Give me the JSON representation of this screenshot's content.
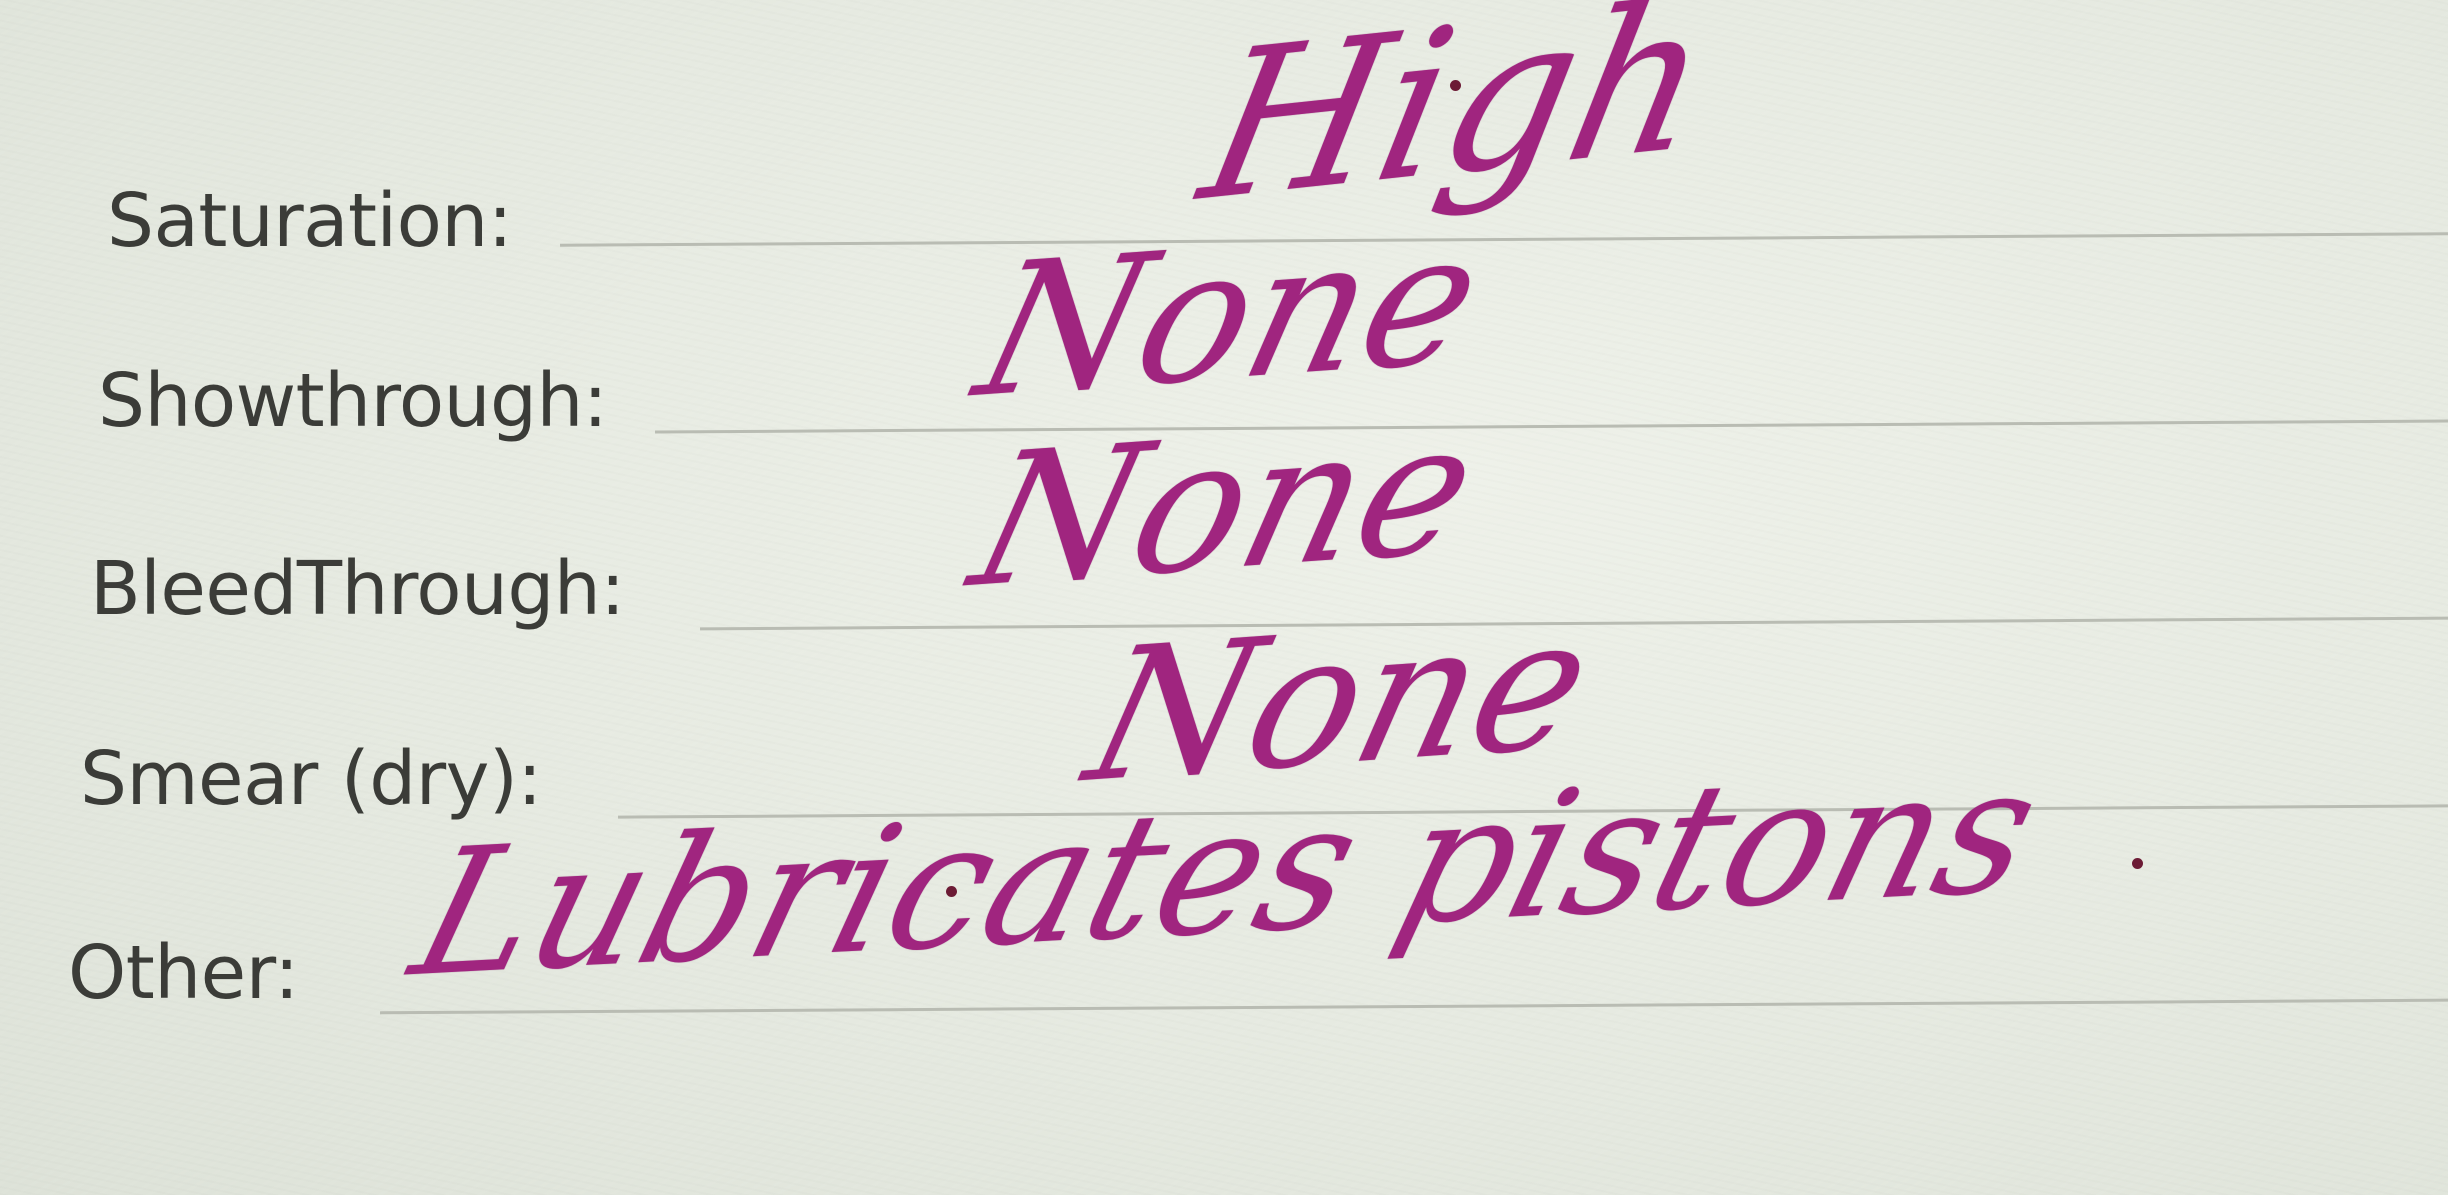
{
  "form": {
    "rows": [
      {
        "label": "Saturation:",
        "value": "High"
      },
      {
        "label": "Showthrough:",
        "value": "None"
      },
      {
        "label": "BleedThrough:",
        "value": "None"
      },
      {
        "label": "Smear (dry):",
        "value": "None"
      },
      {
        "label": "Other:",
        "value": "Lubricates pistons"
      }
    ]
  },
  "colors": {
    "paper": "#e9ece4",
    "printed_text": "#3b3c38",
    "rule_line": "#b9bcb3",
    "ink": "#a0257f"
  }
}
